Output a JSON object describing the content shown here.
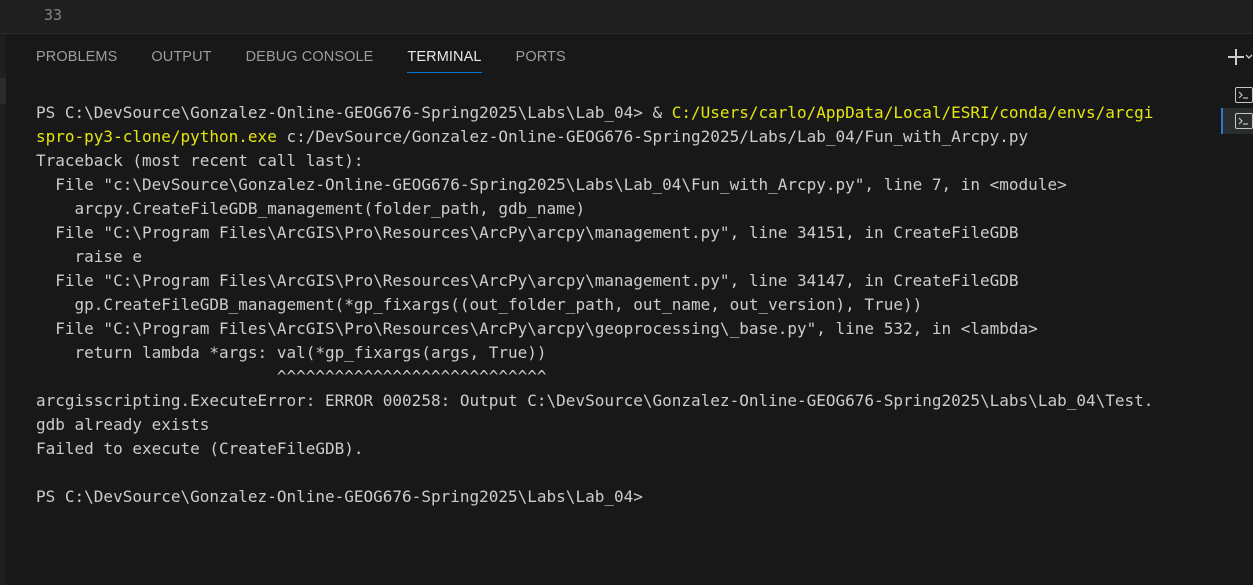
{
  "editor": {
    "line_number": "33"
  },
  "panel": {
    "tabs": [
      {
        "label": "PROBLEMS",
        "active": false
      },
      {
        "label": "OUTPUT",
        "active": false
      },
      {
        "label": "DEBUG CONSOLE",
        "active": false
      },
      {
        "label": "TERMINAL",
        "active": true
      },
      {
        "label": "PORTS",
        "active": false
      }
    ],
    "actions": {
      "new_terminal_icon": "plus-icon",
      "dropdown_icon": "chevron-down-icon"
    }
  },
  "terminal_list": {
    "items": [
      {
        "icon": "terminal-icon",
        "selected": false
      },
      {
        "icon": "terminal-icon",
        "selected": true
      }
    ]
  },
  "terminal": {
    "lines": [
      {
        "parts": [
          {
            "text": "PS C:\\DevSource\\Gonzalez-Online-GEOG676-Spring2025\\Labs\\Lab_04> & "
          },
          {
            "text": "C:/Users/carlo/AppData/Local/ESRI/conda/envs/arcgi",
            "color": "yellow"
          }
        ]
      },
      {
        "parts": [
          {
            "text": "spro-py3-clone/python.exe",
            "color": "yellow"
          },
          {
            "text": " c:/DevSource/Gonzalez-Online-GEOG676-Spring2025/Labs/Lab_04/Fun_with_Arcpy.py"
          }
        ]
      },
      {
        "parts": [
          {
            "text": "Traceback (most recent call last):"
          }
        ]
      },
      {
        "parts": [
          {
            "text": "  File \"c:\\DevSource\\Gonzalez-Online-GEOG676-Spring2025\\Labs\\Lab_04\\Fun_with_Arcpy.py\", line 7, in <module>"
          }
        ]
      },
      {
        "parts": [
          {
            "text": "    arcpy.CreateFileGDB_management(folder_path, gdb_name)"
          }
        ]
      },
      {
        "parts": [
          {
            "text": "  File \"C:\\Program Files\\ArcGIS\\Pro\\Resources\\ArcPy\\arcpy\\management.py\", line 34151, in CreateFileGDB"
          }
        ]
      },
      {
        "parts": [
          {
            "text": "    raise e"
          }
        ]
      },
      {
        "parts": [
          {
            "text": "  File \"C:\\Program Files\\ArcGIS\\Pro\\Resources\\ArcPy\\arcpy\\management.py\", line 34147, in CreateFileGDB"
          }
        ]
      },
      {
        "parts": [
          {
            "text": "    gp.CreateFileGDB_management(*gp_fixargs((out_folder_path, out_name, out_version), True))"
          }
        ]
      },
      {
        "parts": [
          {
            "text": "  File \"C:\\Program Files\\ArcGIS\\Pro\\Resources\\ArcPy\\arcpy\\geoprocessing\\_base.py\", line 532, in <lambda>"
          }
        ]
      },
      {
        "parts": [
          {
            "text": "    return lambda *args: val(*gp_fixargs(args, True))"
          }
        ]
      },
      {
        "parts": [
          {
            "text": "                         ^^^^^^^^^^^^^^^^^^^^^^^^^^^^"
          }
        ]
      },
      {
        "parts": [
          {
            "text": "arcgisscripting.ExecuteError: ERROR 000258: Output C:\\DevSource\\Gonzalez-Online-GEOG676-Spring2025\\Labs\\Lab_04\\Test."
          }
        ]
      },
      {
        "parts": [
          {
            "text": "gdb already exists"
          }
        ]
      },
      {
        "parts": [
          {
            "text": "Failed to execute (CreateFileGDB)."
          }
        ]
      },
      {
        "parts": [
          {
            "text": ""
          }
        ]
      },
      {
        "parts": [
          {
            "text": "PS C:\\DevSource\\Gonzalez-Online-GEOG676-Spring2025\\Labs\\Lab_04>"
          }
        ]
      }
    ]
  },
  "colors": {
    "background": "#181818",
    "text": "#cccccc",
    "yellow": "#e5e510",
    "tab_active_underline": "#0078d4"
  }
}
